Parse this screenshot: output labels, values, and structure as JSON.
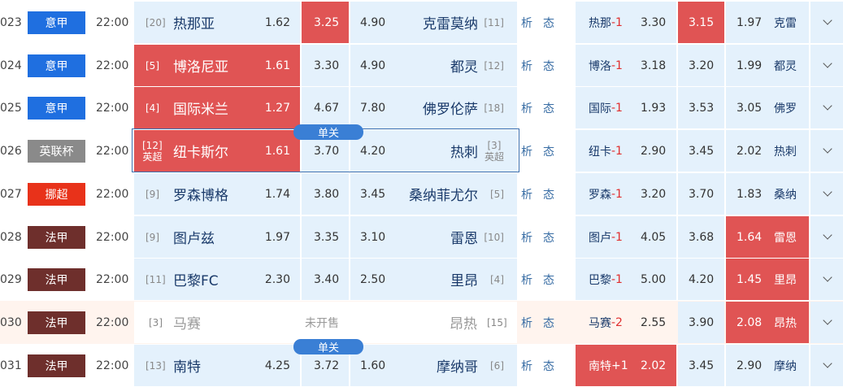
{
  "colors": {
    "red": "#e05454",
    "blue_cell": "#e4f1fc",
    "serie_a": "#1f6fe0",
    "league_cup": "#8a8a8a",
    "eliteserien": "#e8321a",
    "ligue1": "#6e2f2c"
  },
  "icons": {
    "dropdown": "chevron-down-icon"
  },
  "rows": [
    {
      "num": "023",
      "league": "意甲",
      "league_color": "#1f6fe0",
      "time": "22:00",
      "home": {
        "rank": "[20]",
        "name": "热那亚",
        "odd": "1.62",
        "sel": false
      },
      "draw": {
        "odd": "3.25",
        "sel": true
      },
      "away": {
        "odd": "4.90",
        "name": "克雷莫纳",
        "rank": "[11]"
      },
      "analysis": [
        "析",
        "态"
      ],
      "hc": {
        "name": "热那",
        "handicap": "-1",
        "win": "3.30",
        "draw": "3.15",
        "lose": "1.97",
        "away": "克雷",
        "sel_win": false,
        "sel_draw": true,
        "sel_lose": false
      }
    },
    {
      "num": "024",
      "league": "意甲",
      "league_color": "#1f6fe0",
      "time": "22:00",
      "home": {
        "rank": "[5]",
        "name": "博洛尼亚",
        "odd": "1.61",
        "sel": true
      },
      "draw": {
        "odd": "3.30",
        "sel": false
      },
      "away": {
        "odd": "4.90",
        "name": "都灵",
        "rank": "[12]"
      },
      "analysis": [
        "析",
        "态"
      ],
      "hc": {
        "name": "博洛",
        "handicap": "-1",
        "win": "3.18",
        "draw": "3.20",
        "lose": "1.99",
        "away": "都灵",
        "sel_win": false,
        "sel_draw": false,
        "sel_lose": false
      }
    },
    {
      "num": "025",
      "league": "意甲",
      "league_color": "#1f6fe0",
      "time": "22:00",
      "home": {
        "rank": "[4]",
        "name": "国际米兰",
        "odd": "1.27",
        "sel": true
      },
      "draw": {
        "odd": "4.67",
        "sel": false
      },
      "away": {
        "odd": "7.80",
        "name": "佛罗伦萨",
        "rank": "[18]"
      },
      "analysis": [
        "析",
        "态"
      ],
      "hc": {
        "name": "国际",
        "handicap": "-1",
        "win": "1.93",
        "draw": "3.53",
        "lose": "3.05",
        "away": "佛罗",
        "sel_win": false,
        "sel_draw": false,
        "sel_lose": false
      }
    },
    {
      "num": "026",
      "league": "英联杯",
      "league_color": "#8a8a8a",
      "time": "22:00",
      "home": {
        "rank": "[12]",
        "rank2": "英超",
        "name": "纽卡斯尔",
        "odd": "1.61",
        "sel": true
      },
      "draw": {
        "odd": "3.70",
        "sel": false
      },
      "away": {
        "odd": "4.20",
        "name": "热刺",
        "rank": "[3]",
        "rank2": "英超"
      },
      "analysis": [
        "析",
        "态"
      ],
      "single_label": "单关",
      "hc": {
        "name": "纽卡",
        "handicap": "-1",
        "win": "2.90",
        "draw": "3.45",
        "lose": "2.02",
        "away": "热刺",
        "sel_win": false,
        "sel_draw": false,
        "sel_lose": false
      }
    },
    {
      "num": "027",
      "league": "挪超",
      "league_color": "#e8321a",
      "time": "22:00",
      "home": {
        "rank": "[9]",
        "name": "罗森博格",
        "odd": "1.74",
        "sel": false
      },
      "draw": {
        "odd": "3.80",
        "sel": false
      },
      "away": {
        "odd": "3.45",
        "name": "桑纳菲尤尔",
        "rank": "[5]"
      },
      "analysis": [
        "析",
        "态"
      ],
      "hc": {
        "name": "罗森",
        "handicap": "-1",
        "win": "3.20",
        "draw": "3.70",
        "lose": "1.83",
        "away": "桑纳",
        "sel_win": false,
        "sel_draw": false,
        "sel_lose": false
      }
    },
    {
      "num": "028",
      "league": "法甲",
      "league_color": "#6e2f2c",
      "time": "22:00",
      "home": {
        "rank": "[9]",
        "name": "图卢兹",
        "odd": "1.97",
        "sel": false
      },
      "draw": {
        "odd": "3.35",
        "sel": false
      },
      "away": {
        "odd": "3.10",
        "name": "雷恩",
        "rank": "[10]"
      },
      "analysis": [
        "析",
        "态"
      ],
      "hc": {
        "name": "图卢",
        "handicap": "-1",
        "win": "4.05",
        "draw": "3.68",
        "lose": "1.64",
        "away": "雷恩",
        "sel_win": false,
        "sel_draw": false,
        "sel_lose": true
      }
    },
    {
      "num": "029",
      "league": "法甲",
      "league_color": "#6e2f2c",
      "time": "22:00",
      "home": {
        "rank": "[11]",
        "name": "巴黎FC",
        "odd": "2.30",
        "sel": false
      },
      "draw": {
        "odd": "3.40",
        "sel": false
      },
      "away": {
        "odd": "2.50",
        "name": "里昂",
        "rank": "[4]"
      },
      "analysis": [
        "析",
        "态"
      ],
      "hc": {
        "name": "巴黎",
        "handicap": "-1",
        "win": "5.00",
        "draw": "4.20",
        "lose": "1.45",
        "away": "里昂",
        "sel_win": false,
        "sel_draw": false,
        "sel_lose": true
      }
    },
    {
      "num": "030",
      "league": "法甲",
      "league_color": "#6e2f2c",
      "time": "22:00",
      "unsold": true,
      "home": {
        "rank": "[3]",
        "name": "马赛",
        "odd": "",
        "sel": false
      },
      "draw": {
        "odd": "未开售",
        "sel": false
      },
      "away": {
        "odd": "",
        "name": "昂热",
        "rank": "[15]"
      },
      "analysis": [
        "析",
        "态"
      ],
      "hc": {
        "name": "马赛",
        "handicap": "-2",
        "win": "2.55",
        "draw": "3.90",
        "lose": "2.08",
        "away": "昂热",
        "sel_win": false,
        "sel_draw": false,
        "sel_lose": true
      }
    },
    {
      "num": "031",
      "league": "法甲",
      "league_color": "#6e2f2c",
      "time": "22:00",
      "home": {
        "rank": "[13]",
        "name": "南特",
        "odd": "4.25",
        "sel": false
      },
      "draw": {
        "odd": "3.72",
        "sel": false
      },
      "away": {
        "odd": "1.60",
        "name": "摩纳哥",
        "rank": "[6]"
      },
      "analysis": [
        "析",
        "态"
      ],
      "single_label": "单关",
      "hc": {
        "name": "南特",
        "handicap": "+1",
        "win": "2.02",
        "draw": "3.45",
        "lose": "2.90",
        "away": "摩纳",
        "sel_win": true,
        "sel_draw": false,
        "sel_lose": false
      }
    }
  ]
}
